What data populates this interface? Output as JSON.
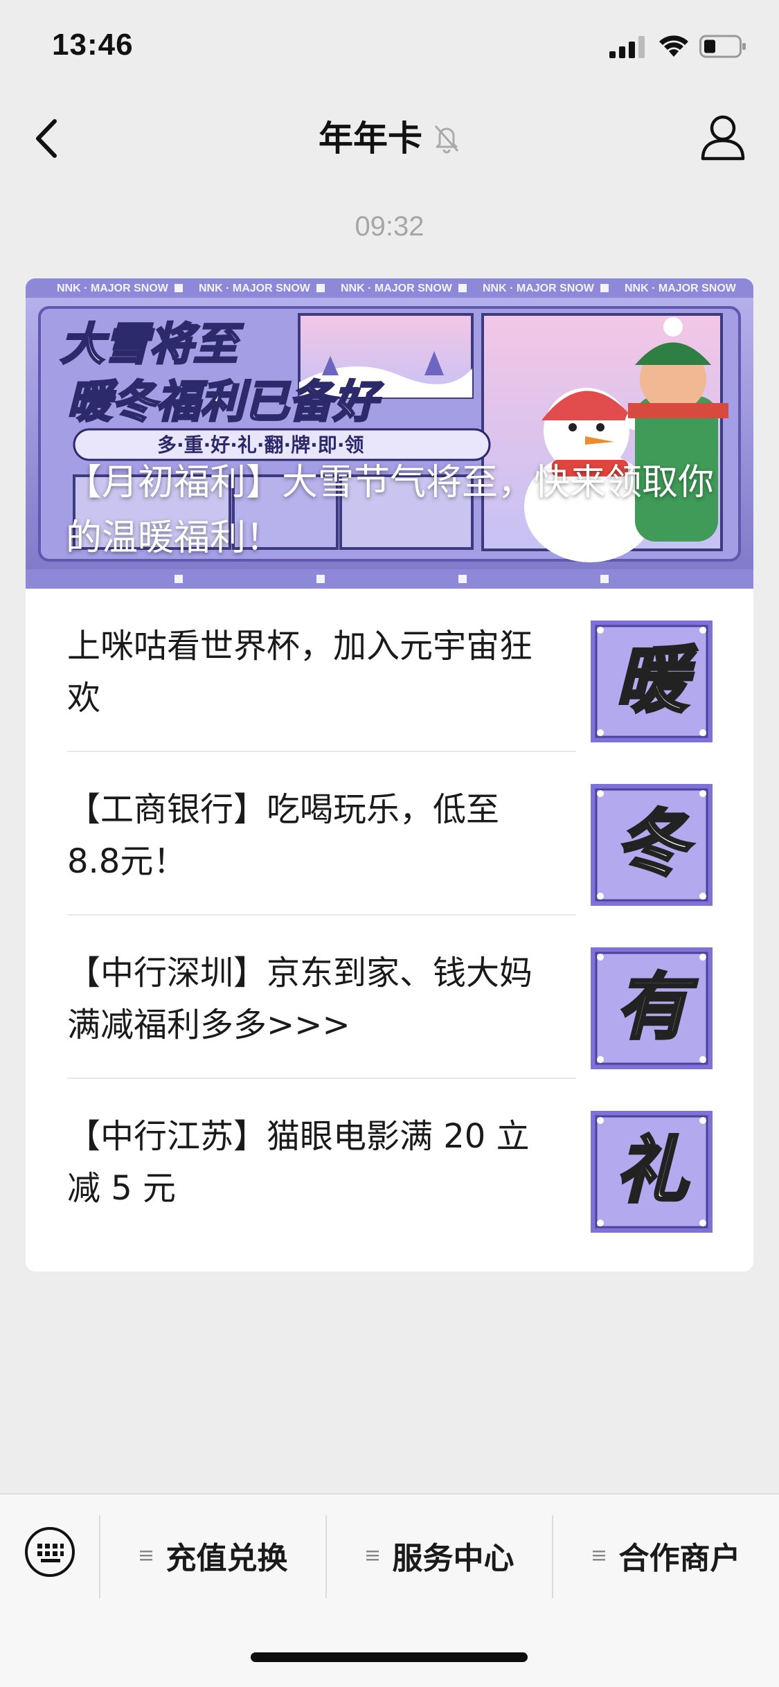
{
  "status_bar": {
    "time": "13:46"
  },
  "nav": {
    "title": "年年卡"
  },
  "chat": {
    "timestamp": "09:32",
    "cover": {
      "title": "【月初福利】大雪节气将至，快来领取你的温暖福利！",
      "banner_headline_1": "大雪将至",
      "banner_headline_2": "暖冬福利已备好",
      "banner_sub": "多·重·好·礼·翻·牌·即·领",
      "banner_tag": "NNK · MAJOR SNOW"
    },
    "articles": [
      {
        "title": "上咪咕看世界杯，加入元宇宙狂欢",
        "thumb_char": "暖"
      },
      {
        "title": "【工商银行】吃喝玩乐，低至8.8元！",
        "thumb_char": "冬"
      },
      {
        "title": "【中行深圳】京东到家、钱大妈满减福利多多>>>",
        "thumb_char": "有"
      },
      {
        "title": "【中行江苏】猫眼电影满 20 立减 5 元",
        "thumb_char": "礼"
      }
    ]
  },
  "menu": {
    "items": [
      {
        "label": "充值兑换"
      },
      {
        "label": "服务中心"
      },
      {
        "label": "合作商户"
      }
    ]
  },
  "colors": {
    "background": "#ededed",
    "card": "#ffffff",
    "banner_purple": "#9b95d6",
    "thumb_purple": "#7f72d6"
  }
}
